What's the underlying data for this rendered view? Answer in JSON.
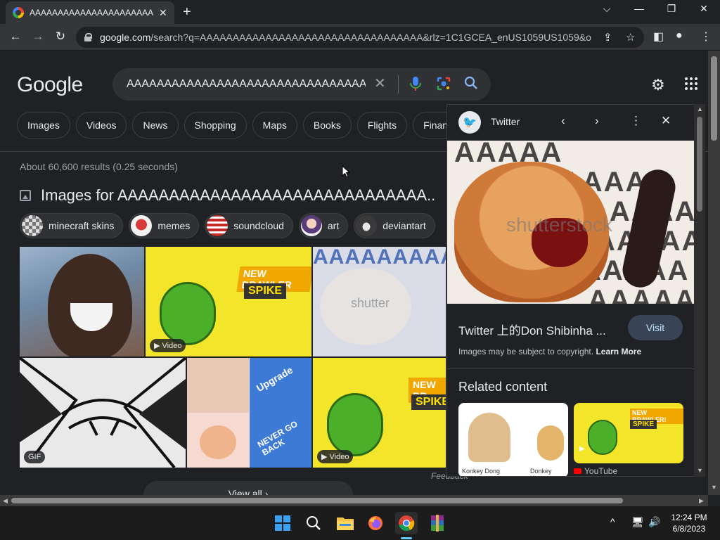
{
  "browser": {
    "tab_title": "AAAAAAAAAAAAAAAAAAAAAAA",
    "tab_close": "✕",
    "new_tab": "+",
    "url_host": "google.com",
    "url_path": "/search?q=AAAAAAAAAAAAAAAAAAAAAAAAAAAAAAAAAA&rlz=1C1GCEA_enUS1059US1059&o..."
  },
  "search": {
    "logo": "Google",
    "query": "AAAAAAAAAAAAAAAAAAAAAAAAAAAAAAAAA"
  },
  "filters": [
    "Images",
    "Videos",
    "News",
    "Shopping",
    "Maps",
    "Books",
    "Flights",
    "Finance"
  ],
  "results": {
    "stats": "About 60,600 results (0.25 seconds)",
    "images_heading": "Images for AAAAAAAAAAAAAAAAAAAAAAAAAAAAAA...",
    "related_chips": [
      "minecraft skins",
      "memes",
      "soundcloud",
      "art",
      "deviantart"
    ],
    "badges": {
      "video": "▶ Video",
      "gif": "GIF",
      "video2": "▶ Video"
    },
    "tile_texts": {
      "brawler": "NEW BRAWLER",
      "spike": "SPIKE",
      "shutter": "shutter",
      "upgrade": "Upgrade",
      "nevergoback": "NEVER GO BACK",
      "newbr": "NEW BR",
      "spike2": "SPIKE"
    },
    "view_all": "View all",
    "feedback": "Feedback"
  },
  "panel": {
    "source": "Twitter",
    "image_watermark": "shutterstock",
    "image_text": "AAAAA",
    "title": "Twitter 上的Don Shibinha ...",
    "visit": "Visit",
    "copyright": "Images may be subject to copyright.",
    "learn_more": "Learn More",
    "related_heading": "Related content",
    "related": [
      {
        "caption_left": "Konkey Dong",
        "caption_right": "Donkey Kong"
      },
      {
        "caption": "YouTube",
        "card_title": "NEW BRAWLER!",
        "card_sub": "SPIKE"
      }
    ]
  },
  "taskbar": {
    "time": "12:24 PM",
    "date": "6/8/2023"
  },
  "colors": {
    "page_bg": "#202124",
    "chip_border": "#3c4043",
    "visit_bg": "#394457",
    "twitter_blue": "#1d9bf0",
    "brawl_yellow": "#f3e62a"
  }
}
